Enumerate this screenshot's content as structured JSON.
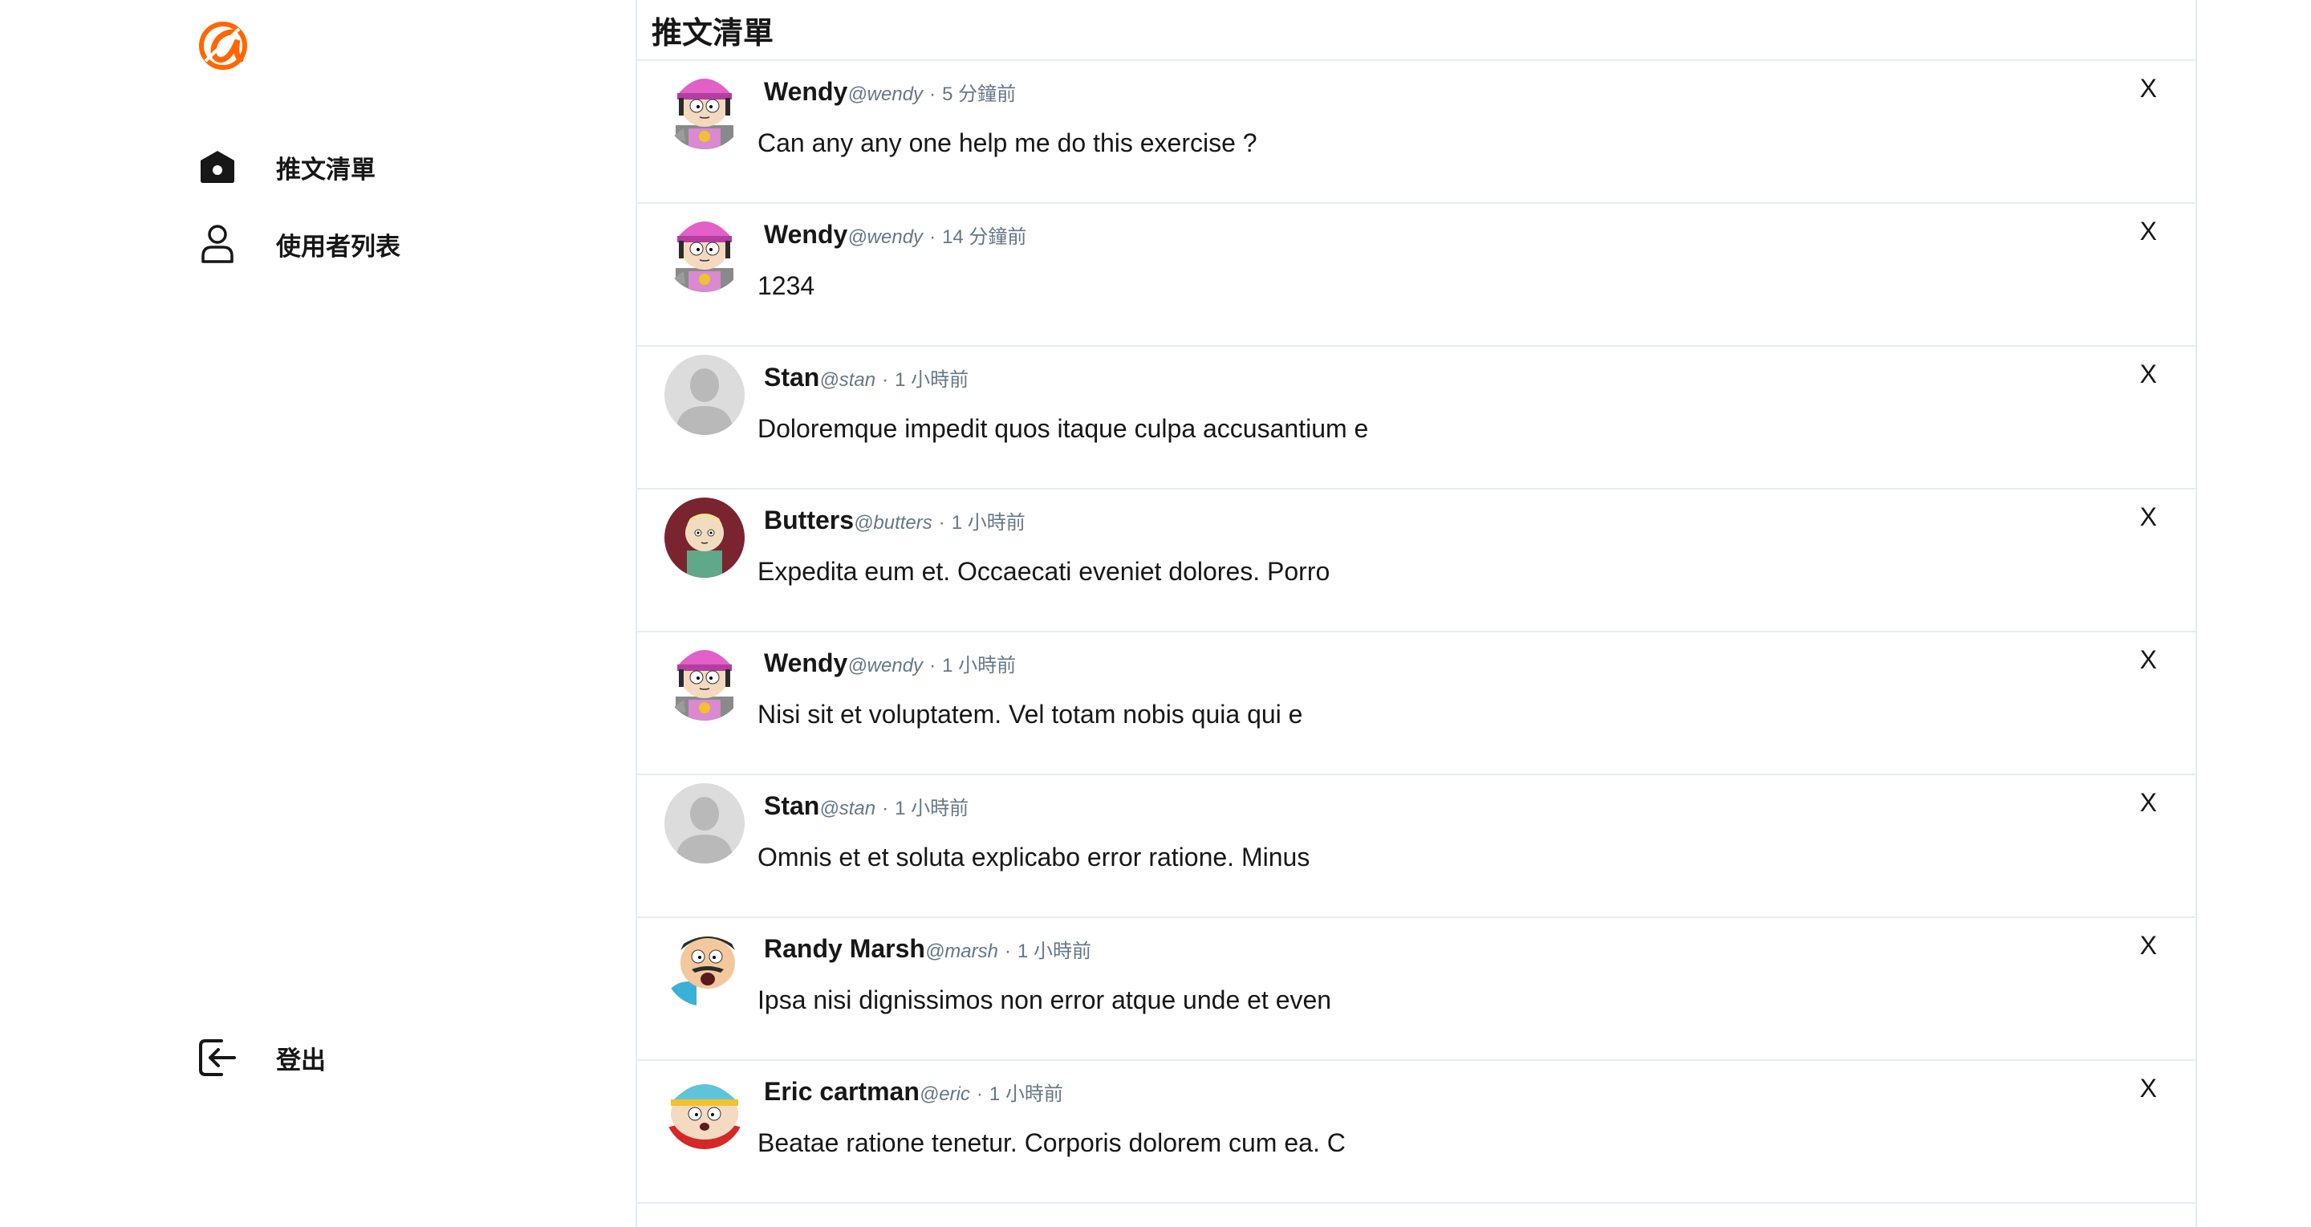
{
  "sidebar": {
    "logo": "alpha-camp-logo",
    "items": [
      {
        "label": "推文清單",
        "icon": "home-icon"
      },
      {
        "label": "使用者列表",
        "icon": "user-icon"
      }
    ],
    "logout": {
      "label": "登出",
      "icon": "logout-icon"
    }
  },
  "main": {
    "title": "推文清單",
    "tweets": [
      {
        "name": "Wendy",
        "handle": "@wendy",
        "time": "5 分鐘前",
        "text": "Can any any one help me do this exercise ?",
        "avatar": "wendy",
        "delete_label": "X"
      },
      {
        "name": "Wendy",
        "handle": "@wendy",
        "time": "14 分鐘前",
        "text": "1234",
        "avatar": "wendy",
        "delete_label": "X"
      },
      {
        "name": "Stan",
        "handle": "@stan",
        "time": "1 小時前",
        "text": "Doloremque impedit quos itaque culpa accusantium e",
        "avatar": "default",
        "delete_label": "X"
      },
      {
        "name": "Butters",
        "handle": "@butters",
        "time": "1 小時前",
        "text": "Expedita eum et. Occaecati eveniet dolores. Porro",
        "avatar": "butters",
        "delete_label": "X"
      },
      {
        "name": "Wendy",
        "handle": "@wendy",
        "time": "1 小時前",
        "text": "Nisi sit et voluptatem. Vel totam nobis quia qui e",
        "avatar": "wendy",
        "delete_label": "X"
      },
      {
        "name": "Stan",
        "handle": "@stan",
        "time": "1 小時前",
        "text": "Omnis et et soluta explicabo error ratione. Minus",
        "avatar": "default",
        "delete_label": "X"
      },
      {
        "name": "Randy Marsh",
        "handle": "@marsh",
        "time": "1 小時前",
        "text": "Ipsa nisi dignissimos non error atque unde et even",
        "avatar": "randy",
        "delete_label": "X"
      },
      {
        "name": "Eric cartman",
        "handle": "@eric",
        "time": "1 小時前",
        "text": "Beatae ratione tenetur. Corporis dolorem cum ea. C",
        "avatar": "eric",
        "delete_label": "X"
      }
    ]
  },
  "colors": {
    "accent": "#ff6600",
    "text": "#171717",
    "muted": "#657786",
    "border": "#e6ecf0"
  }
}
